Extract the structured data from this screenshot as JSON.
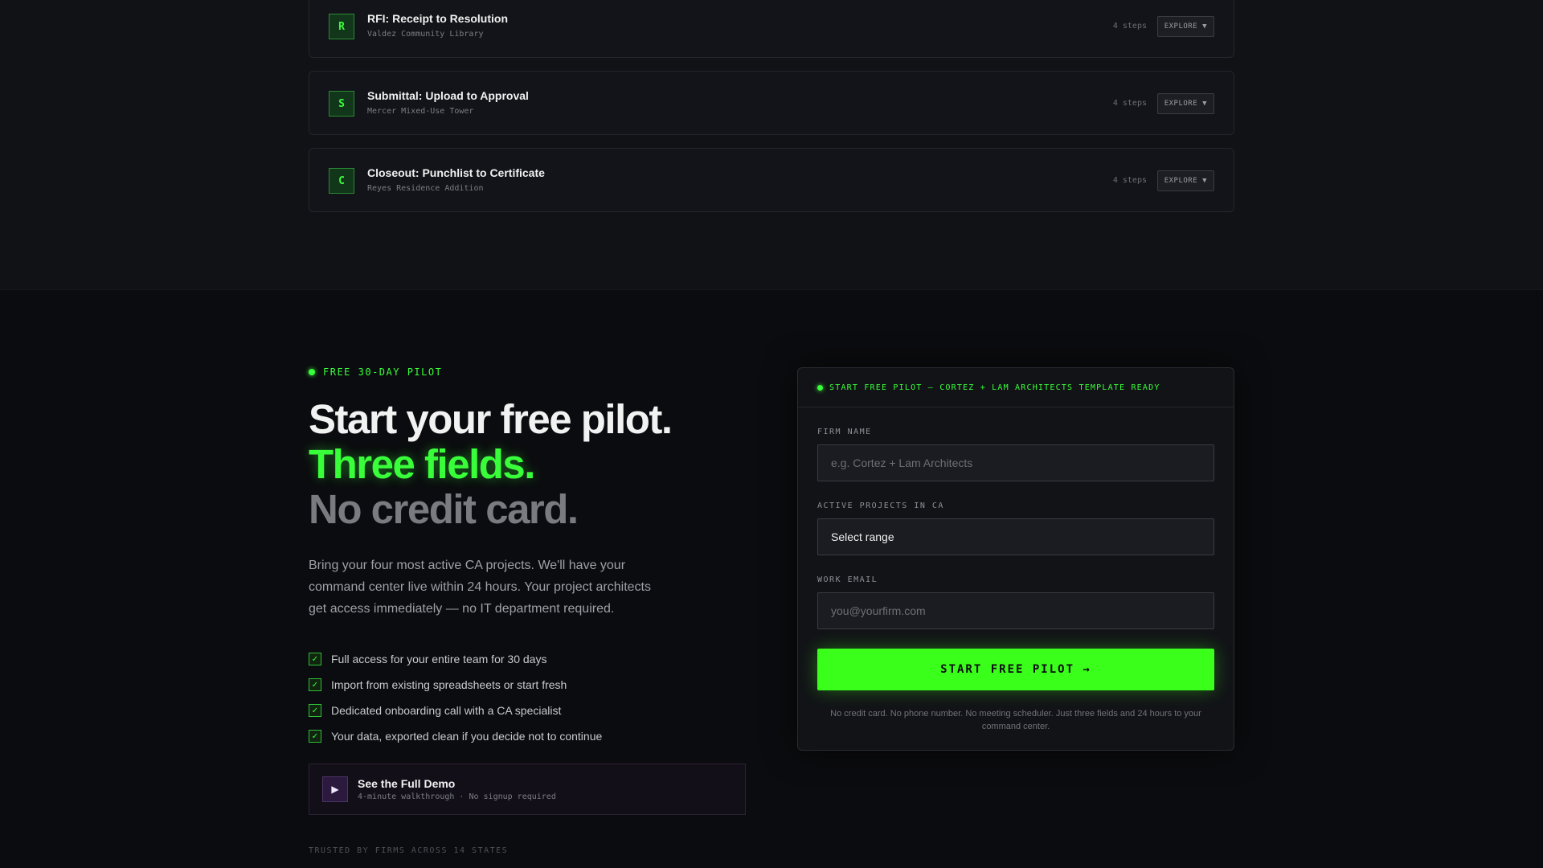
{
  "workflows": [
    {
      "badge": "R",
      "title": "RFI: Receipt to Resolution",
      "project": "Valdez Community Library",
      "steps": "4 steps",
      "action": "EXPLORE ▼"
    },
    {
      "badge": "S",
      "title": "Submittal: Upload to Approval",
      "project": "Mercer Mixed-Use Tower",
      "steps": "4 steps",
      "action": "EXPLORE ▼"
    },
    {
      "badge": "C",
      "title": "Closeout: Punchlist to Certificate",
      "project": "Reyes Residence Addition",
      "steps": "4 steps",
      "action": "EXPLORE ▼"
    }
  ],
  "pilot": {
    "eyebrow": "FREE 30-DAY PILOT",
    "headline_1": "Start your free pilot.",
    "headline_2": "Three fields.",
    "headline_3": "No credit card.",
    "lead": "Bring your four most active CA projects. We'll have your command center live within 24 hours. Your project architects get access immediately — no IT department required.",
    "benefits": [
      "Full access for your entire team for 30 days",
      "Import from existing spreadsheets or start fresh",
      "Dedicated onboarding call with a CA specialist",
      "Your data, exported clean if you decide not to continue"
    ],
    "check_mark": "✓",
    "demo": {
      "icon": "▶",
      "title": "See the Full Demo",
      "subtitle": "4-minute walkthrough · No signup required"
    },
    "trusted": "TRUSTED BY FIRMS ACROSS 14 STATES"
  },
  "form": {
    "header": "START FREE PILOT — CORTEZ + LAM ARCHITECTS TEMPLATE READY",
    "firm_label": "FIRM NAME",
    "firm_placeholder": "e.g. Cortez + Lam Architects",
    "projects_label": "ACTIVE PROJECTS IN CA",
    "projects_value": "Select range",
    "email_label": "WORK EMAIL",
    "email_placeholder": "you@yourfirm.com",
    "submit_label": "START FREE PILOT →",
    "fineprint": "No credit card. No phone number. No meeting scheduler. Just three fields and 24 hours to your command center."
  },
  "colors": {
    "accent": "#39ff3a",
    "background": "#0b0c0f",
    "card": "#121317"
  }
}
